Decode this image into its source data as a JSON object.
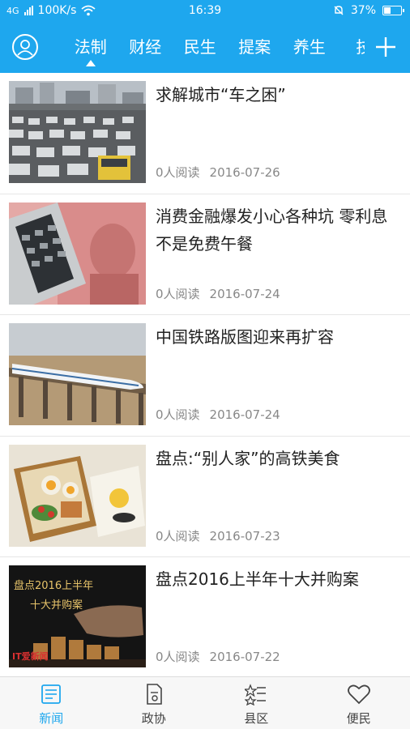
{
  "status_bar": {
    "carrier": "4G",
    "net_speed": "100K/s",
    "time": "16:39",
    "battery": "37%",
    "battery_level": 0.37
  },
  "nav": {
    "tabs": [
      {
        "label": "法制",
        "active": true
      },
      {
        "label": "财经",
        "active": false
      },
      {
        "label": "民生",
        "active": false
      },
      {
        "label": "提案",
        "active": false
      },
      {
        "label": "养生",
        "active": false
      },
      {
        "label": "技",
        "active": false
      }
    ]
  },
  "feed": {
    "items": [
      {
        "title": "求解城市“车之困”",
        "reads": "0人阅读",
        "date": "2016-07-26",
        "image": "traffic-jam"
      },
      {
        "title": "消费金融爆发小心各种坑 零利息不是免费午餐",
        "reads": "0人阅读",
        "date": "2016-07-24",
        "image": "calculator-banknote"
      },
      {
        "title": "中国铁路版图迎来再扩容",
        "reads": "0人阅读",
        "date": "2016-07-24",
        "image": "high-speed-train"
      },
      {
        "title": "盘点:“别人家”的高铁美食",
        "reads": "0人阅读",
        "date": "2016-07-23",
        "image": "bento-box"
      },
      {
        "title": "盘点2016上半年十大并购案",
        "reads": "0人阅读",
        "date": "2016-07-22",
        "image": "coins-hand",
        "image_text": {
          "line1": "盘点2016上半年",
          "line2": "十大并购案",
          "logo": "IT爱新闻"
        }
      }
    ]
  },
  "bottom_nav": {
    "items": [
      {
        "label": "新闻",
        "icon": "news-icon",
        "active": true
      },
      {
        "label": "政协",
        "icon": "document-icon",
        "active": false
      },
      {
        "label": "县区",
        "icon": "star-list-icon",
        "active": false
      },
      {
        "label": "便民",
        "icon": "heart-icon",
        "active": false
      }
    ]
  },
  "colors": {
    "accent": "#1ea7ee"
  }
}
